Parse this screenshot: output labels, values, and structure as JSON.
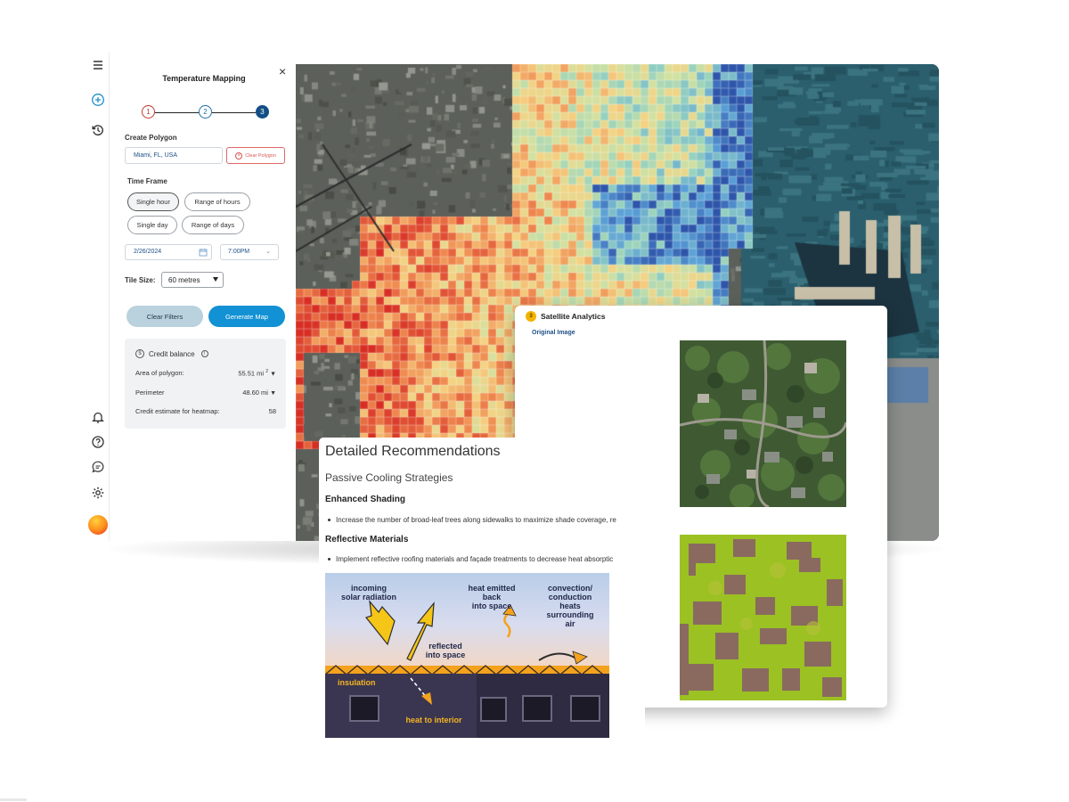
{
  "app": {
    "panel_title": "Temperature Mapping",
    "close_symbol": "×",
    "steps": [
      "1",
      "2",
      "3"
    ],
    "create_polygon_label": "Create Polygon",
    "location_value": "Miami, FL, USA",
    "clear_polygon_label": "Clear Polygon",
    "time_frame_label": "Time Frame",
    "time_options": [
      "Single hour",
      "Range of hours",
      "Single day",
      "Range of days"
    ],
    "selected_time_option": "Single hour",
    "date_value": "2/26/2024",
    "time_value": "7:00PM",
    "tile_size_label": "Tile Size:",
    "tile_size_value": "60 metres",
    "clear_filters_label": "Clear Filters",
    "generate_map_label": "Generate Map",
    "credit": {
      "title": "Credit balance",
      "area_label": "Area of polygon:",
      "area_value": "55.51 mi",
      "area_sup": "2",
      "perimeter_label": "Perimeter",
      "perimeter_value": "48.60 mi",
      "estimate_label": "Credit estimate for heatmap:",
      "estimate_value": "58"
    },
    "accent_color": "#1291d4"
  },
  "icons": {
    "rail": [
      "menu-icon",
      "add-circle-icon",
      "history-icon",
      "bell-icon",
      "help-icon",
      "feedback-icon",
      "settings-icon",
      "avatar"
    ]
  },
  "satellite": {
    "badge": "3",
    "title": "Satellite Analytics",
    "link": "Original Image"
  },
  "recommendations": {
    "title": "Detailed Recommendations",
    "subtitle": "Passive Cooling Strategies",
    "sections": [
      {
        "heading": "Enhanced Shading",
        "bullet": "Increase the number of broad-leaf trees along sidewalks to maximize shade coverage, re"
      },
      {
        "heading": "Reflective Materials",
        "bullet": "Implement reflective roofing materials and façade treatments to decrease heat absorptic"
      }
    ],
    "diagram": {
      "incoming": "incoming\nsolar radiation",
      "reflected": "reflected\ninto space",
      "emitted": "heat emitted\nback\ninto space",
      "convection": "convection/\nconduction\nheats\nsurrounding\nair",
      "insulation": "insulation",
      "interior": "heat to interior"
    }
  }
}
